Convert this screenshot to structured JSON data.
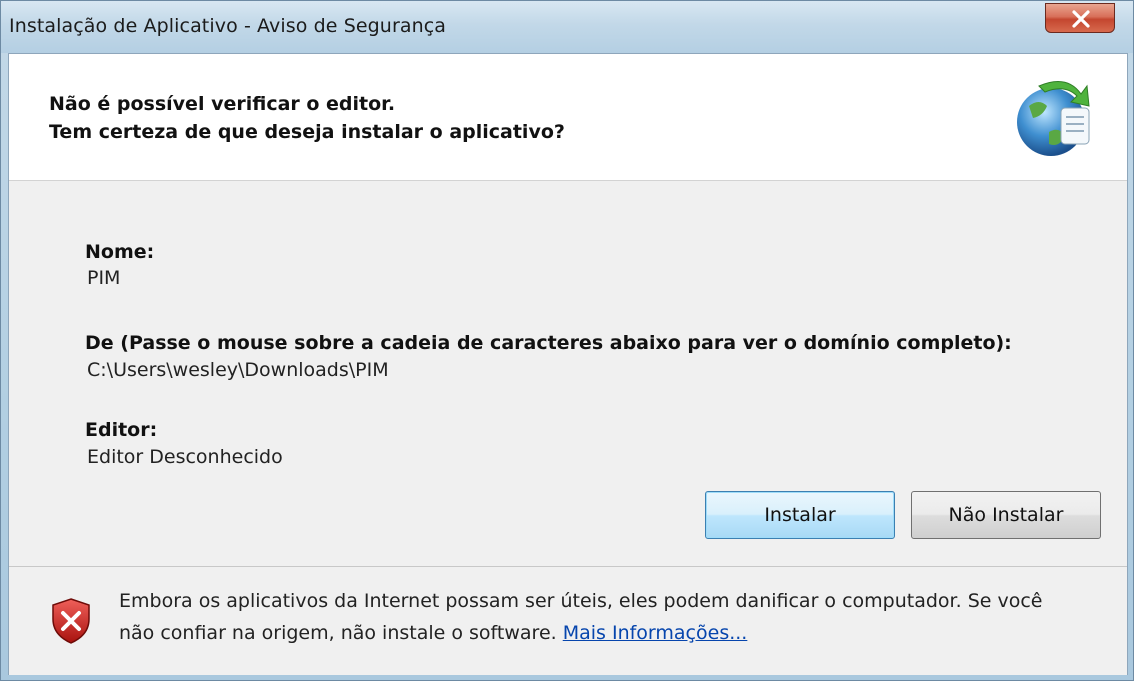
{
  "window": {
    "title": "Instalação de Aplicativo - Aviso de Segurança",
    "close_label": "X"
  },
  "header": {
    "line1": "Não é possível verificar o editor.",
    "line2": "Tem certeza de que deseja instalar o aplicativo?",
    "icon": "globe-install-icon"
  },
  "details": {
    "name_label": "Nome:",
    "name_value": "PIM",
    "from_label": "De (Passe o mouse sobre a cadeia de caracteres abaixo para ver o domínio completo):",
    "from_value": "C:\\Users\\wesley\\Downloads\\PIM",
    "publisher_label": "Editor:",
    "publisher_value": "Editor Desconhecido"
  },
  "buttons": {
    "install": "Instalar",
    "dont_install": "Não Instalar"
  },
  "footer": {
    "icon": "shield-warning-icon",
    "text": "Embora os aplicativos da Internet possam ser úteis, eles podem danificar o computador. Se você não confiar na origem, não instale o software.",
    "link": "Mais Informações..."
  },
  "colors": {
    "link": "#0645ad",
    "shield_red": "#c8201c",
    "default_button_border": "#3c7fb1"
  }
}
